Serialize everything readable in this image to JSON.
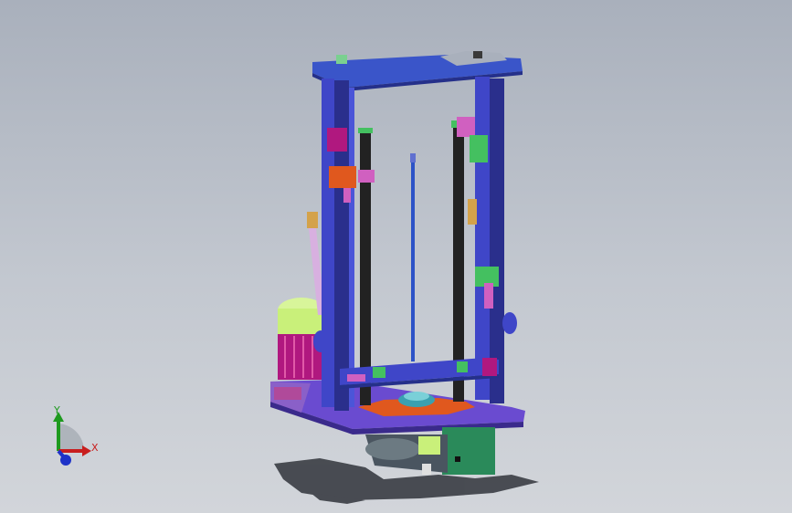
{
  "viewport": {
    "background_top": "#a9b0bc",
    "background_bottom": "#d2d5da"
  },
  "model": {
    "colors": {
      "frame_blue": "#3f46c8",
      "frame_dark": "#2a2f8c",
      "top_plate": "#3a55c9",
      "base_plate": "#6a4bd0",
      "screw_dark": "#222222",
      "guide_rod": "#2d53c7",
      "motor_green": "#c9f07a",
      "motor_magenta": "#b0187f",
      "bracket_orange": "#e0581e",
      "bracket_pink": "#d060c0",
      "bracket_green": "#44c060",
      "mount_teal": "#2a8a5a",
      "shadow": "#3a3d44"
    }
  },
  "triad": {
    "y_label": "Y",
    "x_label": "X",
    "y_color": "#1e9a1e",
    "x_color": "#c81e1e",
    "z_color": "#1e32c8"
  }
}
